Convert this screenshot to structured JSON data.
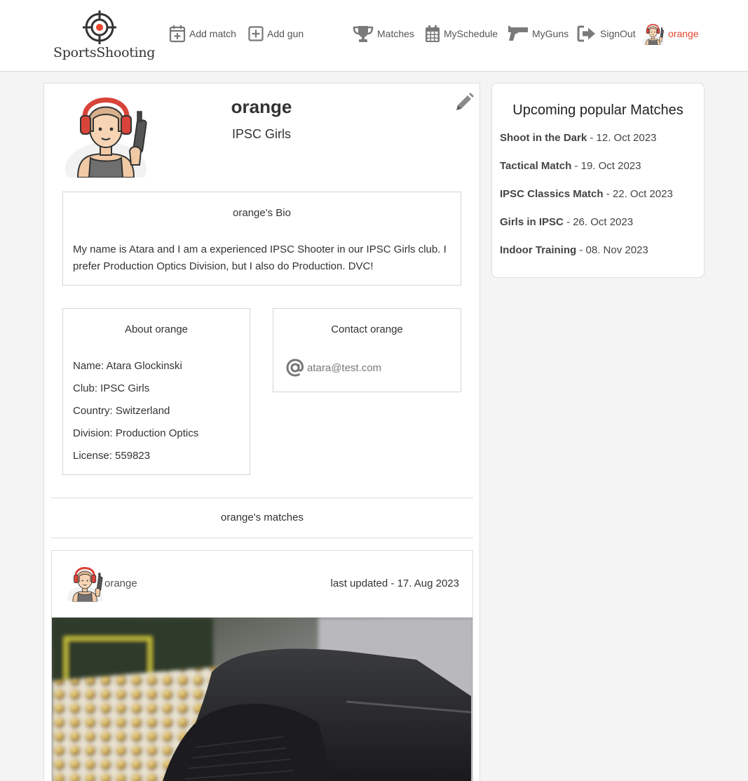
{
  "brand": {
    "name": "SportsShooting",
    "icon": "crosshair-logo"
  },
  "nav": {
    "add_match": "Add match",
    "add_gun": "Add gun",
    "matches": "Matches",
    "schedule": "MySchedule",
    "guns": "MyGuns",
    "signout": "SignOut",
    "user": "orange"
  },
  "profile": {
    "name": "orange",
    "club": "IPSC Girls",
    "bio_title": "orange's Bio",
    "bio_text": "My name is Atara and I am a experienced IPSC Shooter in our IPSC Girls club. I prefer Production Optics Division, but I also do Production. DVC!",
    "about_title": "About orange",
    "about": [
      "Name: Atara Glockinski",
      "Club: IPSC Girls",
      "Country: Switzerland",
      "Division: Production Optics",
      "License: 559823"
    ],
    "contact_title": "Contact orange",
    "email": "atara@test.com"
  },
  "matches_section": {
    "title": "orange's matches",
    "post": {
      "user": "orange",
      "updated": "last updated - 17. Aug 2023"
    }
  },
  "upcoming": {
    "title": "Upcoming popular Matches",
    "items": [
      {
        "name": "Shoot in the Dark",
        "date": " - 12. Oct 2023"
      },
      {
        "name": "Tactical Match",
        "date": " - 19. Oct 2023"
      },
      {
        "name": "IPSC Classics Match",
        "date": " - 22. Oct 2023"
      },
      {
        "name": "Girls in IPSC",
        "date": " - 26. Oct 2023"
      },
      {
        "name": "Indoor Training",
        "date": " - 08. Nov 2023"
      }
    ]
  },
  "colors": {
    "accent": "#e8452c",
    "icon_gray": "#7a7a7a"
  }
}
